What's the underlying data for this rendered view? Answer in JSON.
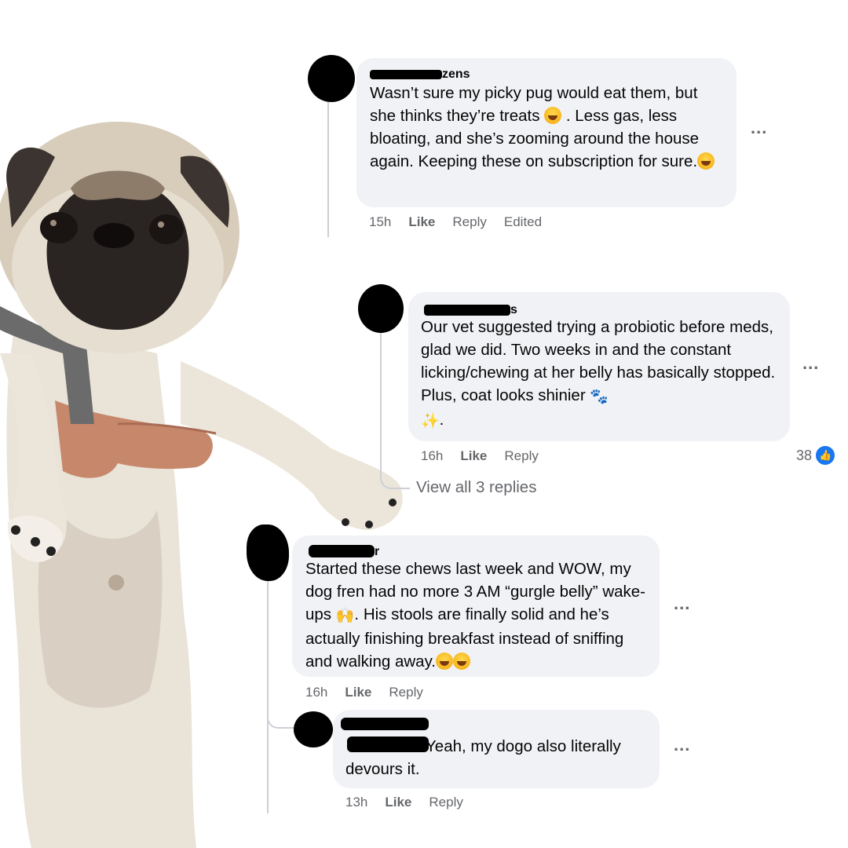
{
  "comments": [
    {
      "author": "zens",
      "text_parts": [
        "Wasn’t sure my picky pug would eat them, but she thinks they’re treats ",
        " . Less gas, less bloating, and she’s zooming around the house again. Keeping these on subscription for sure."
      ],
      "time": "15h",
      "like": "Like",
      "reply": "Reply",
      "edited": "Edited",
      "more": "..."
    },
    {
      "author": "s",
      "text": "Our vet suggested trying a probiotic before meds, glad we did. Two weeks in and the constant licking/chewing at her belly has basically stopped. Plus, coat looks shinier",
      "tail": ".",
      "time": "16h",
      "like": "Like",
      "reply": "Reply",
      "more": "...",
      "reaction_count": "38",
      "view_replies": "View all 3 replies"
    },
    {
      "author": "r",
      "text_parts": [
        "Started these chews last week and WOW, my dog fren had no more 3 AM “gurgle belly” wake-ups ",
        ". His stools are finally solid and he’s actually finishing breakfast instead of sniffing and walking away."
      ],
      "time": "16h",
      "like": "Like",
      "reply": "Reply",
      "more": "..."
    },
    {
      "text": "Yeah, my dogo also literally devours it.",
      "time": "13h",
      "like": "Like",
      "reply": "Reply",
      "more": "..."
    }
  ],
  "icons": {
    "laugh": "laughing-emoji",
    "grin": "grinning-squint-emoji",
    "paws": "paw-prints-emoji",
    "sparkles": "sparkles-emoji",
    "hands": "raising-hands-emoji",
    "like": "thumbs-up-icon"
  },
  "colors": {
    "bubble": "#f0f2f5",
    "meta": "#65676b",
    "like_blue": "#1877f2"
  }
}
